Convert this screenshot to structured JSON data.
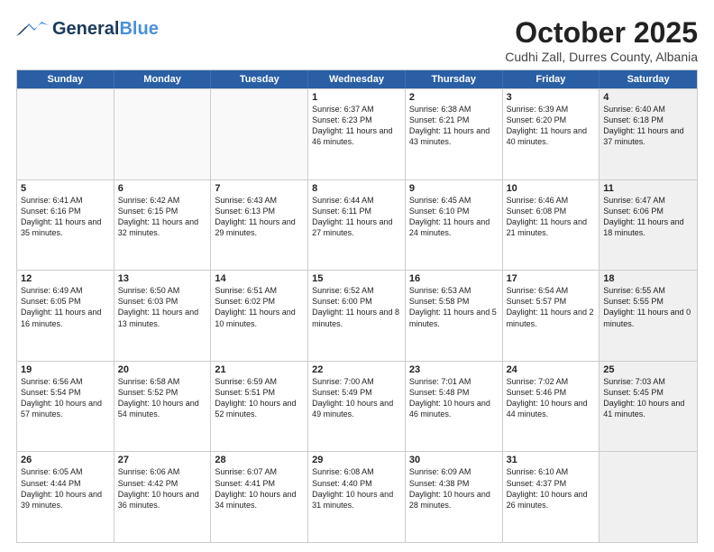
{
  "header": {
    "logo_general": "General",
    "logo_blue": "Blue",
    "month_title": "October 2025",
    "location": "Cudhi Zall, Durres County, Albania"
  },
  "days_of_week": [
    "Sunday",
    "Monday",
    "Tuesday",
    "Wednesday",
    "Thursday",
    "Friday",
    "Saturday"
  ],
  "weeks": [
    [
      {
        "day": "",
        "text": "",
        "empty": true
      },
      {
        "day": "",
        "text": "",
        "empty": true
      },
      {
        "day": "",
        "text": "",
        "empty": true
      },
      {
        "day": "1",
        "text": "Sunrise: 6:37 AM\nSunset: 6:23 PM\nDaylight: 11 hours and 46 minutes.",
        "empty": false
      },
      {
        "day": "2",
        "text": "Sunrise: 6:38 AM\nSunset: 6:21 PM\nDaylight: 11 hours and 43 minutes.",
        "empty": false
      },
      {
        "day": "3",
        "text": "Sunrise: 6:39 AM\nSunset: 6:20 PM\nDaylight: 11 hours and 40 minutes.",
        "empty": false
      },
      {
        "day": "4",
        "text": "Sunrise: 6:40 AM\nSunset: 6:18 PM\nDaylight: 11 hours and 37 minutes.",
        "empty": false,
        "shaded": true
      }
    ],
    [
      {
        "day": "5",
        "text": "Sunrise: 6:41 AM\nSunset: 6:16 PM\nDaylight: 11 hours and 35 minutes.",
        "empty": false
      },
      {
        "day": "6",
        "text": "Sunrise: 6:42 AM\nSunset: 6:15 PM\nDaylight: 11 hours and 32 minutes.",
        "empty": false
      },
      {
        "day": "7",
        "text": "Sunrise: 6:43 AM\nSunset: 6:13 PM\nDaylight: 11 hours and 29 minutes.",
        "empty": false
      },
      {
        "day": "8",
        "text": "Sunrise: 6:44 AM\nSunset: 6:11 PM\nDaylight: 11 hours and 27 minutes.",
        "empty": false
      },
      {
        "day": "9",
        "text": "Sunrise: 6:45 AM\nSunset: 6:10 PM\nDaylight: 11 hours and 24 minutes.",
        "empty": false
      },
      {
        "day": "10",
        "text": "Sunrise: 6:46 AM\nSunset: 6:08 PM\nDaylight: 11 hours and 21 minutes.",
        "empty": false
      },
      {
        "day": "11",
        "text": "Sunrise: 6:47 AM\nSunset: 6:06 PM\nDaylight: 11 hours and 18 minutes.",
        "empty": false,
        "shaded": true
      }
    ],
    [
      {
        "day": "12",
        "text": "Sunrise: 6:49 AM\nSunset: 6:05 PM\nDaylight: 11 hours and 16 minutes.",
        "empty": false
      },
      {
        "day": "13",
        "text": "Sunrise: 6:50 AM\nSunset: 6:03 PM\nDaylight: 11 hours and 13 minutes.",
        "empty": false
      },
      {
        "day": "14",
        "text": "Sunrise: 6:51 AM\nSunset: 6:02 PM\nDaylight: 11 hours and 10 minutes.",
        "empty": false
      },
      {
        "day": "15",
        "text": "Sunrise: 6:52 AM\nSunset: 6:00 PM\nDaylight: 11 hours and 8 minutes.",
        "empty": false
      },
      {
        "day": "16",
        "text": "Sunrise: 6:53 AM\nSunset: 5:58 PM\nDaylight: 11 hours and 5 minutes.",
        "empty": false
      },
      {
        "day": "17",
        "text": "Sunrise: 6:54 AM\nSunset: 5:57 PM\nDaylight: 11 hours and 2 minutes.",
        "empty": false
      },
      {
        "day": "18",
        "text": "Sunrise: 6:55 AM\nSunset: 5:55 PM\nDaylight: 11 hours and 0 minutes.",
        "empty": false,
        "shaded": true
      }
    ],
    [
      {
        "day": "19",
        "text": "Sunrise: 6:56 AM\nSunset: 5:54 PM\nDaylight: 10 hours and 57 minutes.",
        "empty": false
      },
      {
        "day": "20",
        "text": "Sunrise: 6:58 AM\nSunset: 5:52 PM\nDaylight: 10 hours and 54 minutes.",
        "empty": false
      },
      {
        "day": "21",
        "text": "Sunrise: 6:59 AM\nSunset: 5:51 PM\nDaylight: 10 hours and 52 minutes.",
        "empty": false
      },
      {
        "day": "22",
        "text": "Sunrise: 7:00 AM\nSunset: 5:49 PM\nDaylight: 10 hours and 49 minutes.",
        "empty": false
      },
      {
        "day": "23",
        "text": "Sunrise: 7:01 AM\nSunset: 5:48 PM\nDaylight: 10 hours and 46 minutes.",
        "empty": false
      },
      {
        "day": "24",
        "text": "Sunrise: 7:02 AM\nSunset: 5:46 PM\nDaylight: 10 hours and 44 minutes.",
        "empty": false
      },
      {
        "day": "25",
        "text": "Sunrise: 7:03 AM\nSunset: 5:45 PM\nDaylight: 10 hours and 41 minutes.",
        "empty": false,
        "shaded": true
      }
    ],
    [
      {
        "day": "26",
        "text": "Sunrise: 6:05 AM\nSunset: 4:44 PM\nDaylight: 10 hours and 39 minutes.",
        "empty": false
      },
      {
        "day": "27",
        "text": "Sunrise: 6:06 AM\nSunset: 4:42 PM\nDaylight: 10 hours and 36 minutes.",
        "empty": false
      },
      {
        "day": "28",
        "text": "Sunrise: 6:07 AM\nSunset: 4:41 PM\nDaylight: 10 hours and 34 minutes.",
        "empty": false
      },
      {
        "day": "29",
        "text": "Sunrise: 6:08 AM\nSunset: 4:40 PM\nDaylight: 10 hours and 31 minutes.",
        "empty": false
      },
      {
        "day": "30",
        "text": "Sunrise: 6:09 AM\nSunset: 4:38 PM\nDaylight: 10 hours and 28 minutes.",
        "empty": false
      },
      {
        "day": "31",
        "text": "Sunrise: 6:10 AM\nSunset: 4:37 PM\nDaylight: 10 hours and 26 minutes.",
        "empty": false
      },
      {
        "day": "",
        "text": "",
        "empty": true,
        "shaded": true
      }
    ]
  ]
}
